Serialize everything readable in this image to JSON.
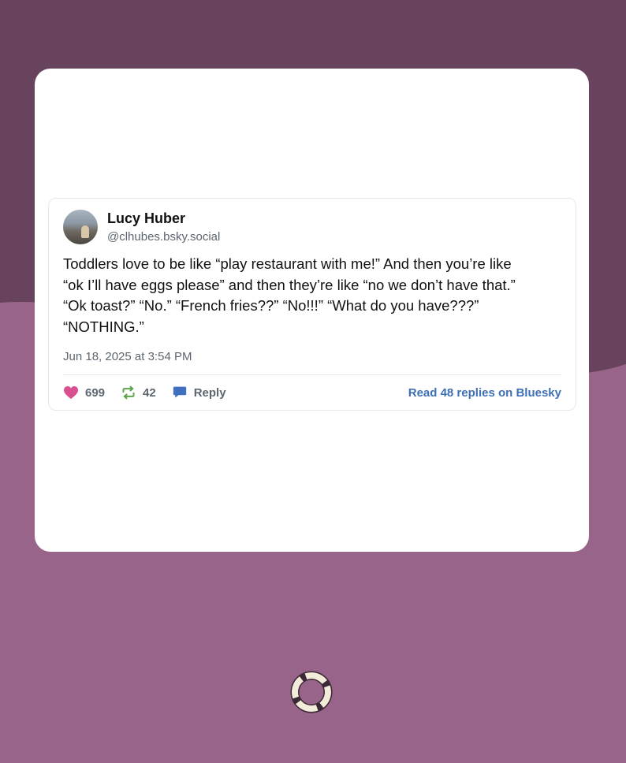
{
  "post": {
    "author_name": "Lucy Huber",
    "author_handle": "@clhubes.bsky.social",
    "text": "Toddlers love to be like “play restaurant with me!” And then you’re like\n“ok I’ll have eggs please” and then they’re like “no we don’t have that.”\n“Ok toast?” “No.” “French fries??” “No!!!” “What do you have???”\n“NOTHING.”",
    "timestamp": "Jun 18, 2025 at 3:54 PM",
    "likes": "699",
    "reposts": "42",
    "reply_label": "Reply",
    "read_replies_label": "Read 48 replies on Bluesky"
  },
  "icons": {
    "like": "heart-icon",
    "repost": "repost-icon",
    "reply": "speech-bubble-icon",
    "app_logo": "lifebuoy-ring-icon"
  },
  "colors": {
    "background_light": "#996489",
    "background_dark": "#67435e",
    "heart": "#d94f92",
    "repost": "#5ba44a",
    "reply": "#3f6fbf",
    "link": "#3d6fb5"
  }
}
